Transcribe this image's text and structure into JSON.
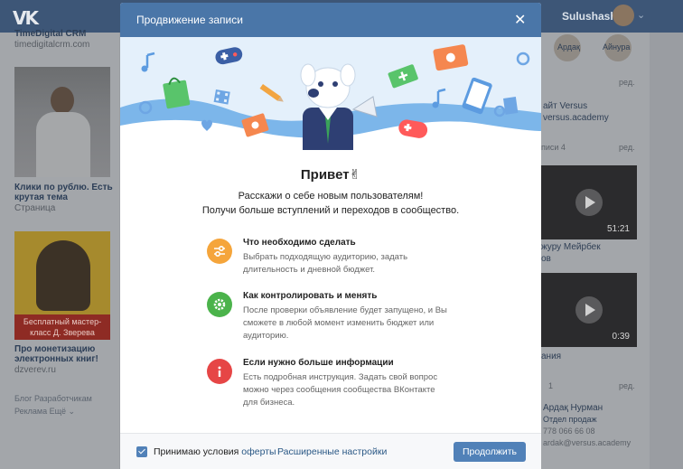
{
  "topbar": {
    "logo": "VK",
    "username": "Sulushash"
  },
  "left_column": {
    "group_name": "TimeDigital CRM",
    "group_domain": "timedigitalcrm.com",
    "ad1_title_1": "Клики по рублю. Есть",
    "ad1_title_2": "крутая тема",
    "ad1_type": "Страница",
    "ad2_banner_1": "Бесплатный мастер-",
    "ad2_banner_2": "класс Д. Зверева",
    "ad2_title_1": "Про монетизацию",
    "ad2_title_2": "электронных книг!",
    "ad2_domain": "dzverev.ru",
    "links_1": "Блог  Разработчикам",
    "links_2": "Реклама    Ещё ⌄"
  },
  "right_column": {
    "friend_1": "Ардақ",
    "friend_2": "Айнура",
    "edit_1": "ред.",
    "site_label": "айт Versus",
    "site_url": "versus.academy",
    "videos_label": "писи  4",
    "edit_2": "ред.",
    "video1_duration": "51:21",
    "video1_caption_1": "журу Мейрбек",
    "video1_caption_2": "ов",
    "video2_duration": "0:39",
    "video2_caption": "ания",
    "contacts_count": "1",
    "edit_3": "ред.",
    "contact_name": "Ардақ Нурман",
    "contact_role": "Отдел продаж",
    "contact_phone": "778 066 66 08",
    "contact_email": "ardak@versus.academy"
  },
  "modal": {
    "title": "Продвижение записи",
    "greeting": "Привет✌",
    "subtitle_line1": "Расскажи о себе новым пользователям!",
    "subtitle_line2": "Получи больше вступлений и переходов в сообщество.",
    "items": [
      {
        "icon": "sliders-icon",
        "title": "Что необходимо сделать",
        "desc_1": "Выбрать подходящую аудиторию, задать",
        "desc_2": "длительность и дневной бюджет.",
        "desc_3": ""
      },
      {
        "icon": "gear-icon",
        "title": "Как контролировать и менять",
        "desc_1": "После проверки объявление будет запущено, и Вы",
        "desc_2": "сможете в любой момент изменить бюджет или",
        "desc_3": "аудиторию."
      },
      {
        "icon": "info-icon",
        "title": "Если нужно больше информации",
        "desc_1": "Есть подробная инструкция. Задать свой вопрос",
        "desc_2": "можно через сообщения сообщества ВКонтакте",
        "desc_3": "для бизнеса."
      }
    ],
    "footer": {
      "accept_text": "Принимаю условия",
      "offer_link": "оферты",
      "advanced_link": "Расширенные настройки",
      "continue_button": "Продолжить"
    }
  },
  "colors": {
    "header": "#4a76a8",
    "button": "#5181b8",
    "orange_icon": "#f5a53b",
    "green_icon": "#4bb34b",
    "red_icon": "#e64646",
    "banner_bg": "#e4f0fb"
  }
}
